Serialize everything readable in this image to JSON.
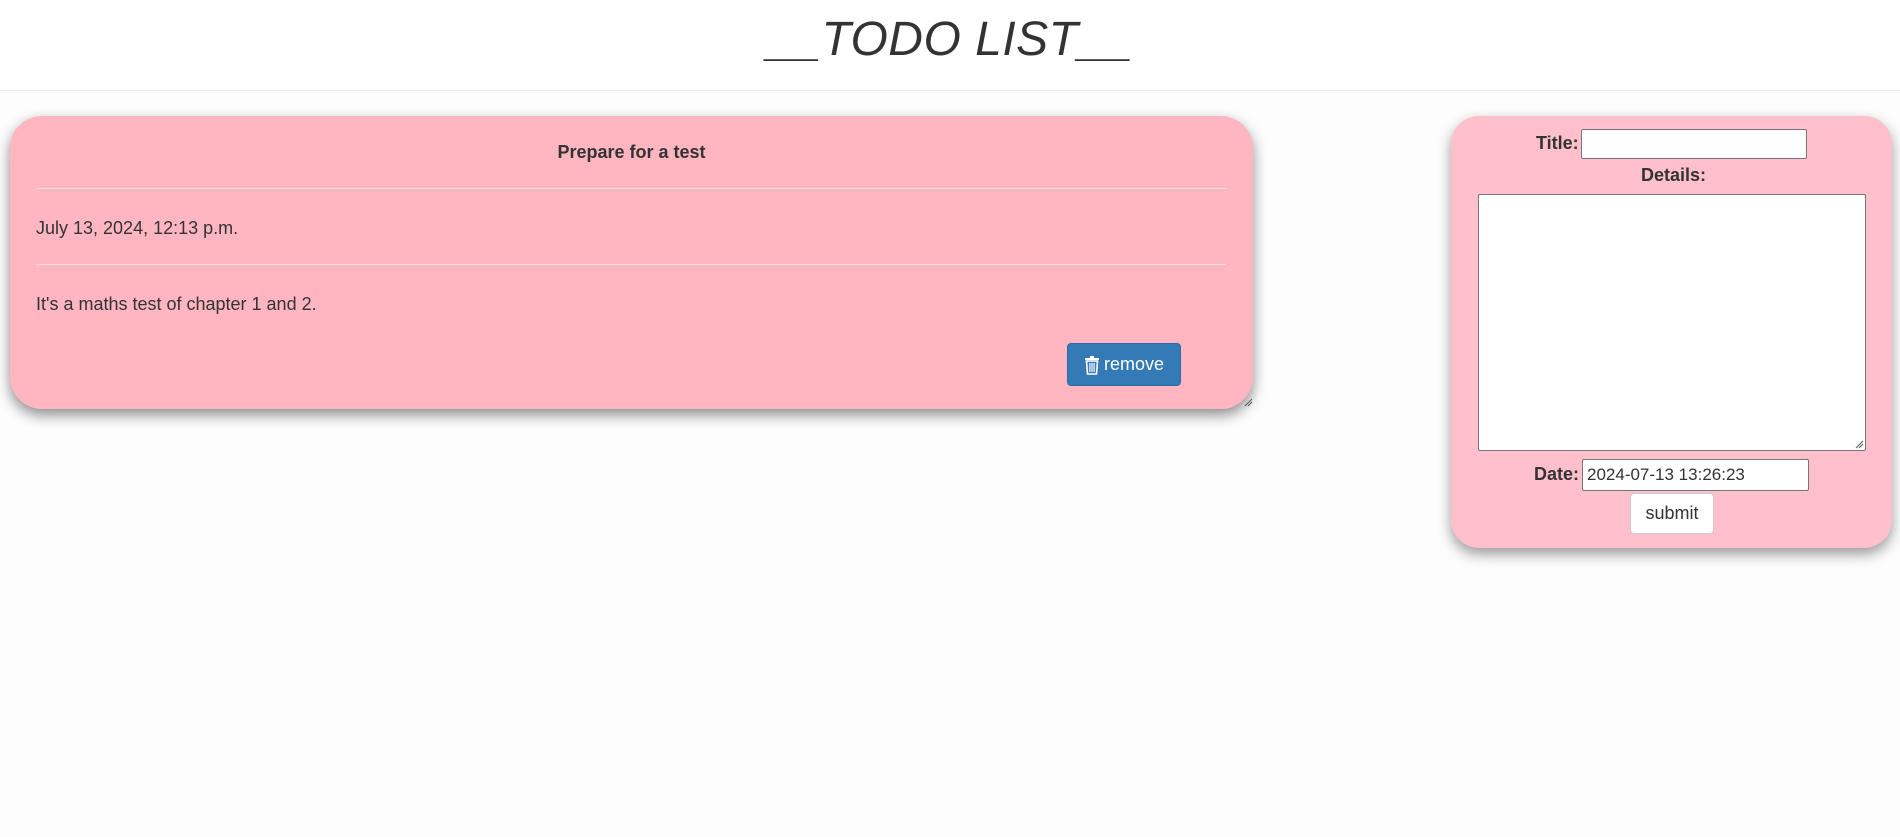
{
  "header": {
    "title": "__TODO LIST__"
  },
  "todos": [
    {
      "title": "Prepare for a test",
      "date": "July 13, 2024, 12:13 p.m.",
      "details": "It's a maths test of chapter 1 and 2.",
      "remove_label": "remove",
      "remove_icon": "trash-icon"
    }
  ],
  "form": {
    "title_label": "Title:",
    "title_value": "",
    "details_label": "Details:",
    "details_value": "",
    "date_label": "Date:",
    "date_value": "2024-07-13 13:26:23",
    "submit_label": "submit"
  },
  "colors": {
    "todo_card_bg": "#ffb6c1",
    "form_card_bg": "#ffc0cb",
    "remove_button": "#337ab7"
  }
}
